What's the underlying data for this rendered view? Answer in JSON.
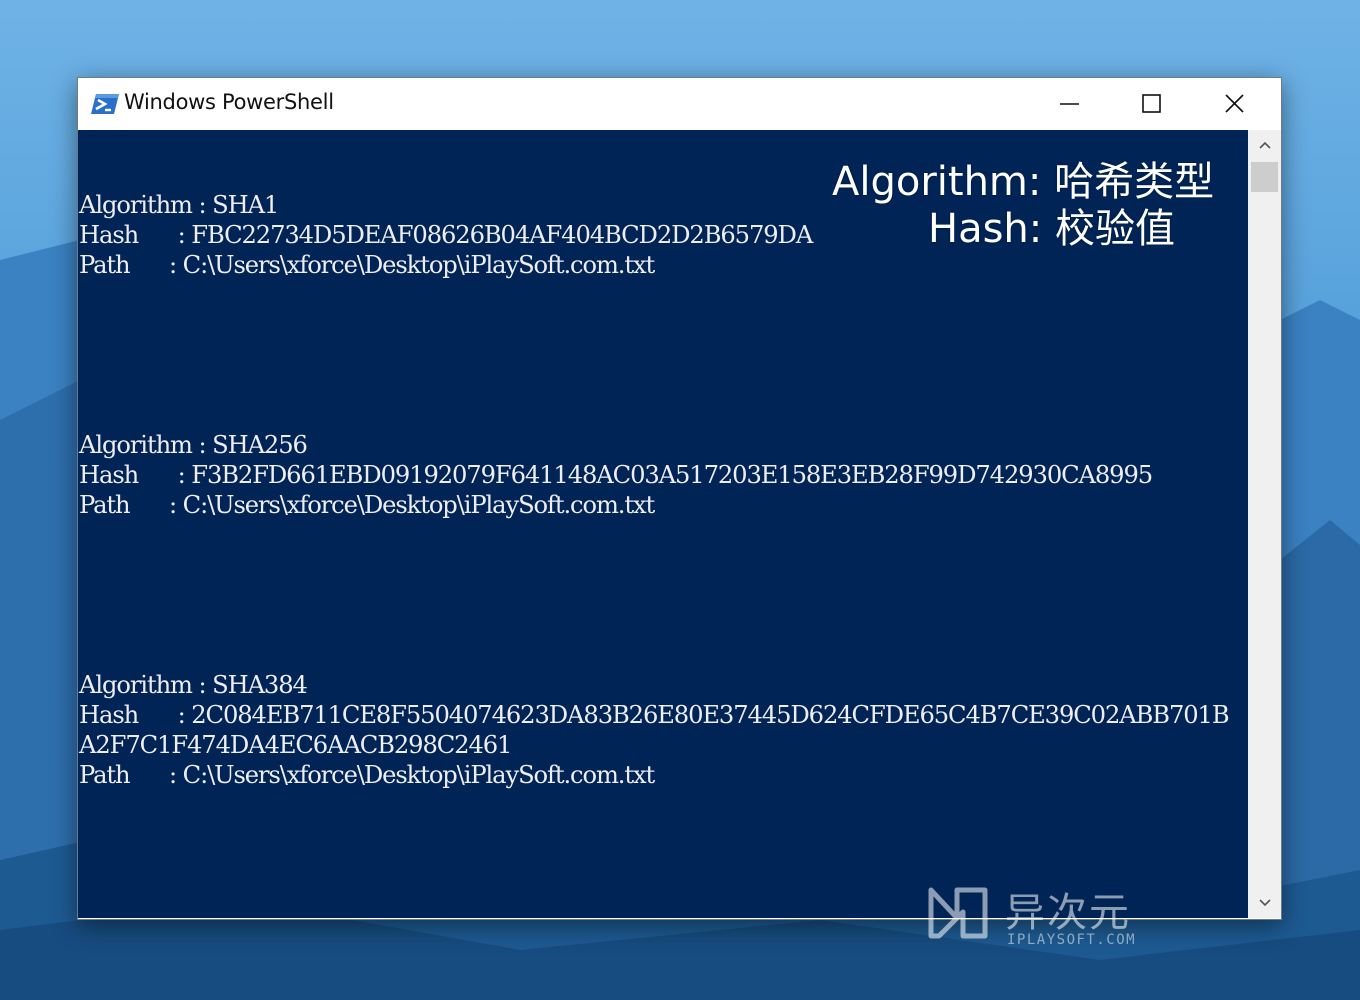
{
  "window": {
    "title": "Windows PowerShell"
  },
  "console": {
    "lines": [
      "Algorithm : SHA1",
      "Hash      : FBC22734D5DEAF08626B04AF404BCD2D2B6579DA",
      "Path      : C:\\Users\\xforce\\Desktop\\iPlaySoft.com.txt",
      "Algorithm : SHA256",
      "Hash      : F3B2FD661EBD09192079F641148AC03A517203E158E3EB28F99D742930CA8995",
      "Path      : C:\\Users\\xforce\\Desktop\\iPlaySoft.com.txt",
      "Algorithm : SHA384",
      "Hash      : 2C084EB711CE8F5504074623DA83B26E80E37445D624CFDE65C4B7CE39C02ABB701B",
      "A2F7C1F474DA4EC6AACB298C2461",
      "Path      : C:\\Users\\xforce\\Desktop\\iPlaySoft.com.txt"
    ]
  },
  "annotation": {
    "line1": "Algorithm: 哈希类型",
    "line2": "Hash: 校验值"
  },
  "watermark": {
    "name": "异次元",
    "domain": "IPLAYSOFT.COM"
  },
  "colors": {
    "console_bg": "#012456",
    "console_fg": "#eeedf0",
    "titlebar_bg": "#ffffff"
  },
  "icons": {
    "app": "powershell-icon",
    "minimize": "minimize-icon",
    "maximize": "maximize-icon",
    "close": "close-icon"
  }
}
